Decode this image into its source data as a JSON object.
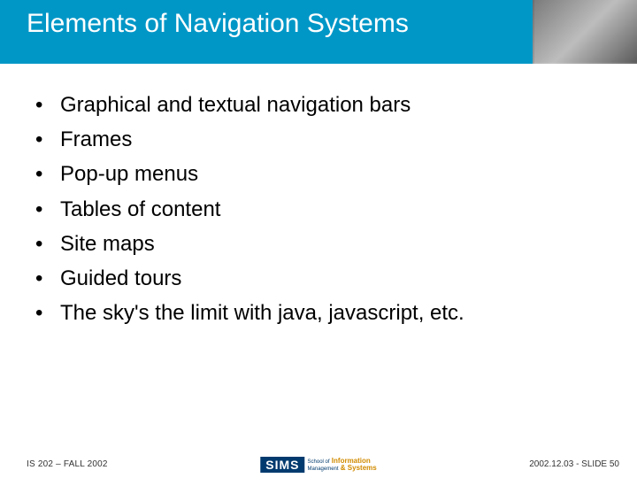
{
  "title": "Elements of Navigation Systems",
  "bullets": [
    "Graphical and textual navigation bars",
    "Frames",
    "Pop-up menus",
    "Tables of content",
    "Site maps",
    "Guided tours",
    "The sky's the limit with java, javascript, etc."
  ],
  "footer": {
    "left": "IS 202 – FALL 2002",
    "right": "2002.12.03 - SLIDE 50",
    "logo_main": "SIMS",
    "logo_line1_small": "School of",
    "logo_line1_em": "Information",
    "logo_line2_small": "Management",
    "logo_line2_em": "& Systems"
  }
}
